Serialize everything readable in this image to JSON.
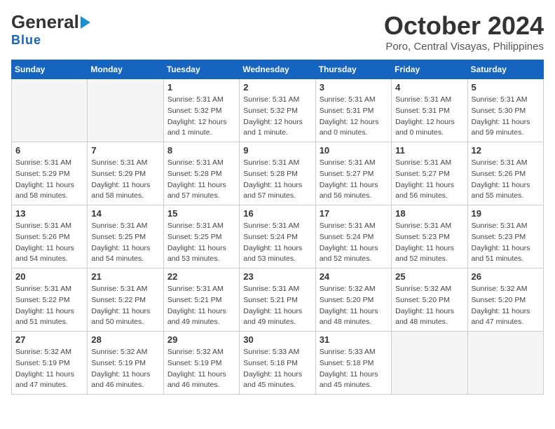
{
  "header": {
    "logo_line1_g": "General",
    "logo_line2": "Blue",
    "month_title": "October 2024",
    "location": "Poro, Central Visayas, Philippines"
  },
  "weekdays": [
    "Sunday",
    "Monday",
    "Tuesday",
    "Wednesday",
    "Thursday",
    "Friday",
    "Saturday"
  ],
  "weeks": [
    [
      {
        "day": "",
        "detail": ""
      },
      {
        "day": "",
        "detail": ""
      },
      {
        "day": "1",
        "detail": "Sunrise: 5:31 AM\nSunset: 5:32 PM\nDaylight: 12 hours\nand 1 minute."
      },
      {
        "day": "2",
        "detail": "Sunrise: 5:31 AM\nSunset: 5:32 PM\nDaylight: 12 hours\nand 1 minute."
      },
      {
        "day": "3",
        "detail": "Sunrise: 5:31 AM\nSunset: 5:31 PM\nDaylight: 12 hours\nand 0 minutes."
      },
      {
        "day": "4",
        "detail": "Sunrise: 5:31 AM\nSunset: 5:31 PM\nDaylight: 12 hours\nand 0 minutes."
      },
      {
        "day": "5",
        "detail": "Sunrise: 5:31 AM\nSunset: 5:30 PM\nDaylight: 11 hours\nand 59 minutes."
      }
    ],
    [
      {
        "day": "6",
        "detail": "Sunrise: 5:31 AM\nSunset: 5:29 PM\nDaylight: 11 hours\nand 58 minutes."
      },
      {
        "day": "7",
        "detail": "Sunrise: 5:31 AM\nSunset: 5:29 PM\nDaylight: 11 hours\nand 58 minutes."
      },
      {
        "day": "8",
        "detail": "Sunrise: 5:31 AM\nSunset: 5:28 PM\nDaylight: 11 hours\nand 57 minutes."
      },
      {
        "day": "9",
        "detail": "Sunrise: 5:31 AM\nSunset: 5:28 PM\nDaylight: 11 hours\nand 57 minutes."
      },
      {
        "day": "10",
        "detail": "Sunrise: 5:31 AM\nSunset: 5:27 PM\nDaylight: 11 hours\nand 56 minutes."
      },
      {
        "day": "11",
        "detail": "Sunrise: 5:31 AM\nSunset: 5:27 PM\nDaylight: 11 hours\nand 56 minutes."
      },
      {
        "day": "12",
        "detail": "Sunrise: 5:31 AM\nSunset: 5:26 PM\nDaylight: 11 hours\nand 55 minutes."
      }
    ],
    [
      {
        "day": "13",
        "detail": "Sunrise: 5:31 AM\nSunset: 5:26 PM\nDaylight: 11 hours\nand 54 minutes."
      },
      {
        "day": "14",
        "detail": "Sunrise: 5:31 AM\nSunset: 5:25 PM\nDaylight: 11 hours\nand 54 minutes."
      },
      {
        "day": "15",
        "detail": "Sunrise: 5:31 AM\nSunset: 5:25 PM\nDaylight: 11 hours\nand 53 minutes."
      },
      {
        "day": "16",
        "detail": "Sunrise: 5:31 AM\nSunset: 5:24 PM\nDaylight: 11 hours\nand 53 minutes."
      },
      {
        "day": "17",
        "detail": "Sunrise: 5:31 AM\nSunset: 5:24 PM\nDaylight: 11 hours\nand 52 minutes."
      },
      {
        "day": "18",
        "detail": "Sunrise: 5:31 AM\nSunset: 5:23 PM\nDaylight: 11 hours\nand 52 minutes."
      },
      {
        "day": "19",
        "detail": "Sunrise: 5:31 AM\nSunset: 5:23 PM\nDaylight: 11 hours\nand 51 minutes."
      }
    ],
    [
      {
        "day": "20",
        "detail": "Sunrise: 5:31 AM\nSunset: 5:22 PM\nDaylight: 11 hours\nand 51 minutes."
      },
      {
        "day": "21",
        "detail": "Sunrise: 5:31 AM\nSunset: 5:22 PM\nDaylight: 11 hours\nand 50 minutes."
      },
      {
        "day": "22",
        "detail": "Sunrise: 5:31 AM\nSunset: 5:21 PM\nDaylight: 11 hours\nand 49 minutes."
      },
      {
        "day": "23",
        "detail": "Sunrise: 5:31 AM\nSunset: 5:21 PM\nDaylight: 11 hours\nand 49 minutes."
      },
      {
        "day": "24",
        "detail": "Sunrise: 5:32 AM\nSunset: 5:20 PM\nDaylight: 11 hours\nand 48 minutes."
      },
      {
        "day": "25",
        "detail": "Sunrise: 5:32 AM\nSunset: 5:20 PM\nDaylight: 11 hours\nand 48 minutes."
      },
      {
        "day": "26",
        "detail": "Sunrise: 5:32 AM\nSunset: 5:20 PM\nDaylight: 11 hours\nand 47 minutes."
      }
    ],
    [
      {
        "day": "27",
        "detail": "Sunrise: 5:32 AM\nSunset: 5:19 PM\nDaylight: 11 hours\nand 47 minutes."
      },
      {
        "day": "28",
        "detail": "Sunrise: 5:32 AM\nSunset: 5:19 PM\nDaylight: 11 hours\nand 46 minutes."
      },
      {
        "day": "29",
        "detail": "Sunrise: 5:32 AM\nSunset: 5:19 PM\nDaylight: 11 hours\nand 46 minutes."
      },
      {
        "day": "30",
        "detail": "Sunrise: 5:33 AM\nSunset: 5:18 PM\nDaylight: 11 hours\nand 45 minutes."
      },
      {
        "day": "31",
        "detail": "Sunrise: 5:33 AM\nSunset: 5:18 PM\nDaylight: 11 hours\nand 45 minutes."
      },
      {
        "day": "",
        "detail": ""
      },
      {
        "day": "",
        "detail": ""
      }
    ]
  ]
}
